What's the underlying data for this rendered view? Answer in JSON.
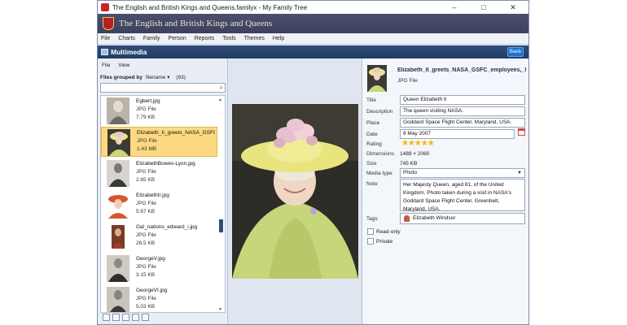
{
  "window": {
    "title": "The English and British Kings and Queens.familyx - My Family Tree",
    "controls": [
      "–",
      "□",
      "✕"
    ]
  },
  "brand": {
    "title": "The English and British Kings and Queens"
  },
  "menubar": [
    "File",
    "Charts",
    "Family",
    "Person",
    "Reports",
    "Tools",
    "Themes",
    "Help"
  ],
  "panel": {
    "title": "Multimedia",
    "back_label": "Back"
  },
  "left": {
    "menu": [
      "File",
      "View"
    ],
    "group_label": "Files grouped by",
    "group_value": "filename",
    "group_caret": "▾",
    "count": "(83)",
    "search_placeholder": "",
    "files": [
      {
        "name": "Egbert.jpg",
        "type": "JPG File",
        "size": "7.79 KB",
        "selected": false
      },
      {
        "name": "Elizabeth_II_greets_NASA_GSFC...",
        "type": "JPG File",
        "size": "1.43 MB",
        "selected": true
      },
      {
        "name": "ElizabethBowes-Lyon.jpg",
        "type": "JPG File",
        "size": "2.65 KB",
        "selected": false
      },
      {
        "name": "ElizabethII.jpg",
        "type": "JPG File",
        "size": "5.67 KB",
        "selected": false
      },
      {
        "name": "Gal_nations_edward_i.jpg",
        "type": "JPG File",
        "size": "26.5 KB",
        "selected": false
      },
      {
        "name": "GeorgeV.jpg",
        "type": "JPG File",
        "size": "3.15 KB",
        "selected": false
      },
      {
        "name": "GeorgeVI.jpg",
        "type": "JPG File",
        "size": "5.03 KB",
        "selected": false
      }
    ]
  },
  "props": {
    "title_text": "Elizabeth_II_greets_NASA_GSFC_employees,_May_...",
    "file_type": "JPG File",
    "fields": {
      "title_label": "Title",
      "title_value": "Queen Elizabeth II",
      "description_label": "Description",
      "description_value": "The queen visiting NASA.",
      "place_label": "Place",
      "place_value": "Goddard Space Flight Center. Maryland, USA.",
      "date_label": "Date",
      "date_value": "8 May 2007",
      "rating_label": "Rating",
      "rating_stars": "★★★★★",
      "dimensions_label": "Dimensions",
      "dimensions_value": "1488 × 2060",
      "size_label": "Size",
      "size_value": "745 KB",
      "media_type_label": "Media type",
      "media_type_value": "Photo",
      "note_label": "Note",
      "note_value": "Her Majesty Queen, aged 81, of the United Kingdom. Photo taken during a visit in NASA's Goddard Space Flight Center. Greenbelt, Maryland, USA.",
      "tags_label": "Tags",
      "tag_person": "Elizabeth Windsor",
      "read_only_label": "Read-only",
      "private_label": "Private"
    },
    "rating": 5
  }
}
